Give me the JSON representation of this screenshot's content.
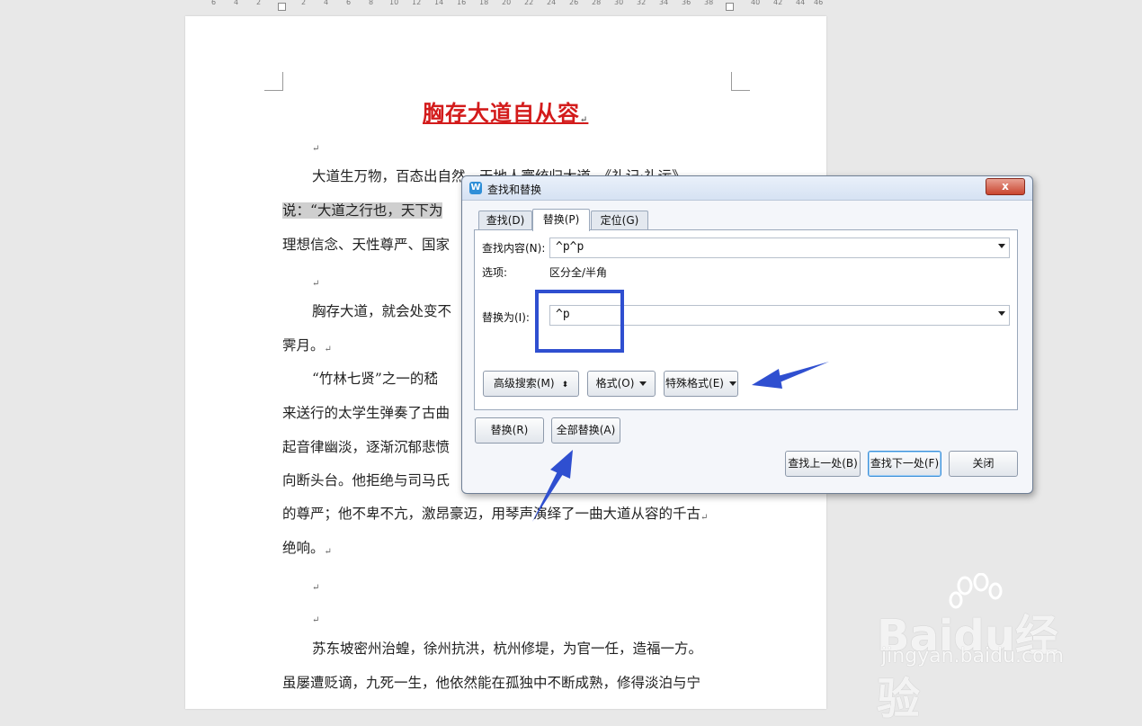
{
  "ruler": {
    "ticks": [
      "6",
      "4",
      "2",
      "2",
      "4",
      "6",
      "8",
      "10",
      "12",
      "14",
      "16",
      "18",
      "20",
      "22",
      "24",
      "26",
      "28",
      "30",
      "32",
      "34",
      "36",
      "38",
      "40",
      "42",
      "44",
      "46"
    ]
  },
  "document": {
    "title": "胸存大道自从容",
    "para_mark": "↵",
    "lines": [
      "大道生万物，百态出自然，天地人寰统归大道。《礼记·礼运》",
      "说：“大道之行也，天下为",
      "理想信念、天性尊严、国家",
      "胸存大道，就会处变不",
      "霁月。",
      "“竹林七贤”之一的嵇",
      "来送行的太学生弹奏了古曲",
      "起音律幽淡，逐渐沉郁悲愤",
      "向断头台。他拒绝与司马氏",
      "的尊严；他不卑不亢，激昂豪迈，用琴声演绎了一曲大道从容的千古",
      "绝响。",
      "苏东坡密州治蝗，徐州抗洪，杭州修堤，为官一任，造福一方。",
      "虽屡遭贬谪，九死一生，他依然能在孤独中不断成熟，修得淡泊与宁"
    ]
  },
  "dialog": {
    "title": "查找和替换",
    "close_label": "x",
    "tabs": [
      {
        "label": "查找(D)"
      },
      {
        "label": "替换(P)"
      },
      {
        "label": "定位(G)"
      }
    ],
    "find_label": "查找内容(N):",
    "find_value": "^p^p",
    "options_label": "选项:",
    "options_value": "区分全/半角",
    "replace_label": "替换为(I):",
    "replace_value": "^p",
    "advanced_search": "高级搜索(M)",
    "format": "格式(O)",
    "special_format": "特殊格式(E)",
    "replace_btn": "替换(R)",
    "replace_all_btn": "全部替换(A)",
    "find_prev_btn": "查找上一处(B)",
    "find_next_btn": "查找下一处(F)",
    "close_btn": "关闭"
  },
  "watermark": {
    "brand": "Baidu经验",
    "sub": "jingyan.baidu.com"
  },
  "colors": {
    "title_red": "#d31b1b",
    "annotation_blue": "#2f4fd0",
    "dialog_bg": "#f4f6fa"
  }
}
